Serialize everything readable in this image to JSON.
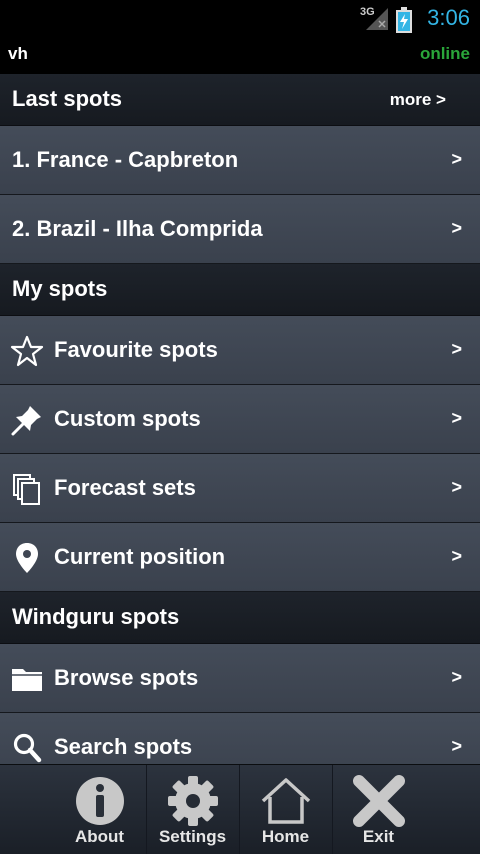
{
  "status_bar": {
    "network": "3G",
    "time": "3:06"
  },
  "title_bar": {
    "user": "vh",
    "status": "online"
  },
  "last_spots": {
    "title": "Last spots",
    "more_label": "more >",
    "items": [
      {
        "label": "1. France - Capbreton",
        "arrow": ">"
      },
      {
        "label": "2. Brazil - Ilha Comprida",
        "arrow": ">"
      }
    ]
  },
  "my_spots": {
    "title": "My spots",
    "items": [
      {
        "label": "Favourite spots",
        "icon": "star-icon",
        "arrow": ">"
      },
      {
        "label": "Custom spots",
        "icon": "pin-icon",
        "arrow": ">"
      },
      {
        "label": "Forecast sets",
        "icon": "copy-icon",
        "arrow": ">"
      },
      {
        "label": "Current position",
        "icon": "location-icon",
        "arrow": ">"
      }
    ]
  },
  "windguru_spots": {
    "title": "Windguru spots",
    "items": [
      {
        "label": "Browse spots",
        "icon": "folder-icon",
        "arrow": ">"
      },
      {
        "label": "Search spots",
        "icon": "search-icon",
        "arrow": ">"
      }
    ]
  },
  "bottom_nav": [
    {
      "label": "About",
      "icon": "info-icon"
    },
    {
      "label": "Settings",
      "icon": "gear-icon"
    },
    {
      "label": "Home",
      "icon": "home-icon"
    },
    {
      "label": "Exit",
      "icon": "close-icon"
    }
  ],
  "colors": {
    "clock": "#33b5e5",
    "online": "#2aa63a",
    "row": "#3b4350",
    "section": "#1a1e25"
  }
}
